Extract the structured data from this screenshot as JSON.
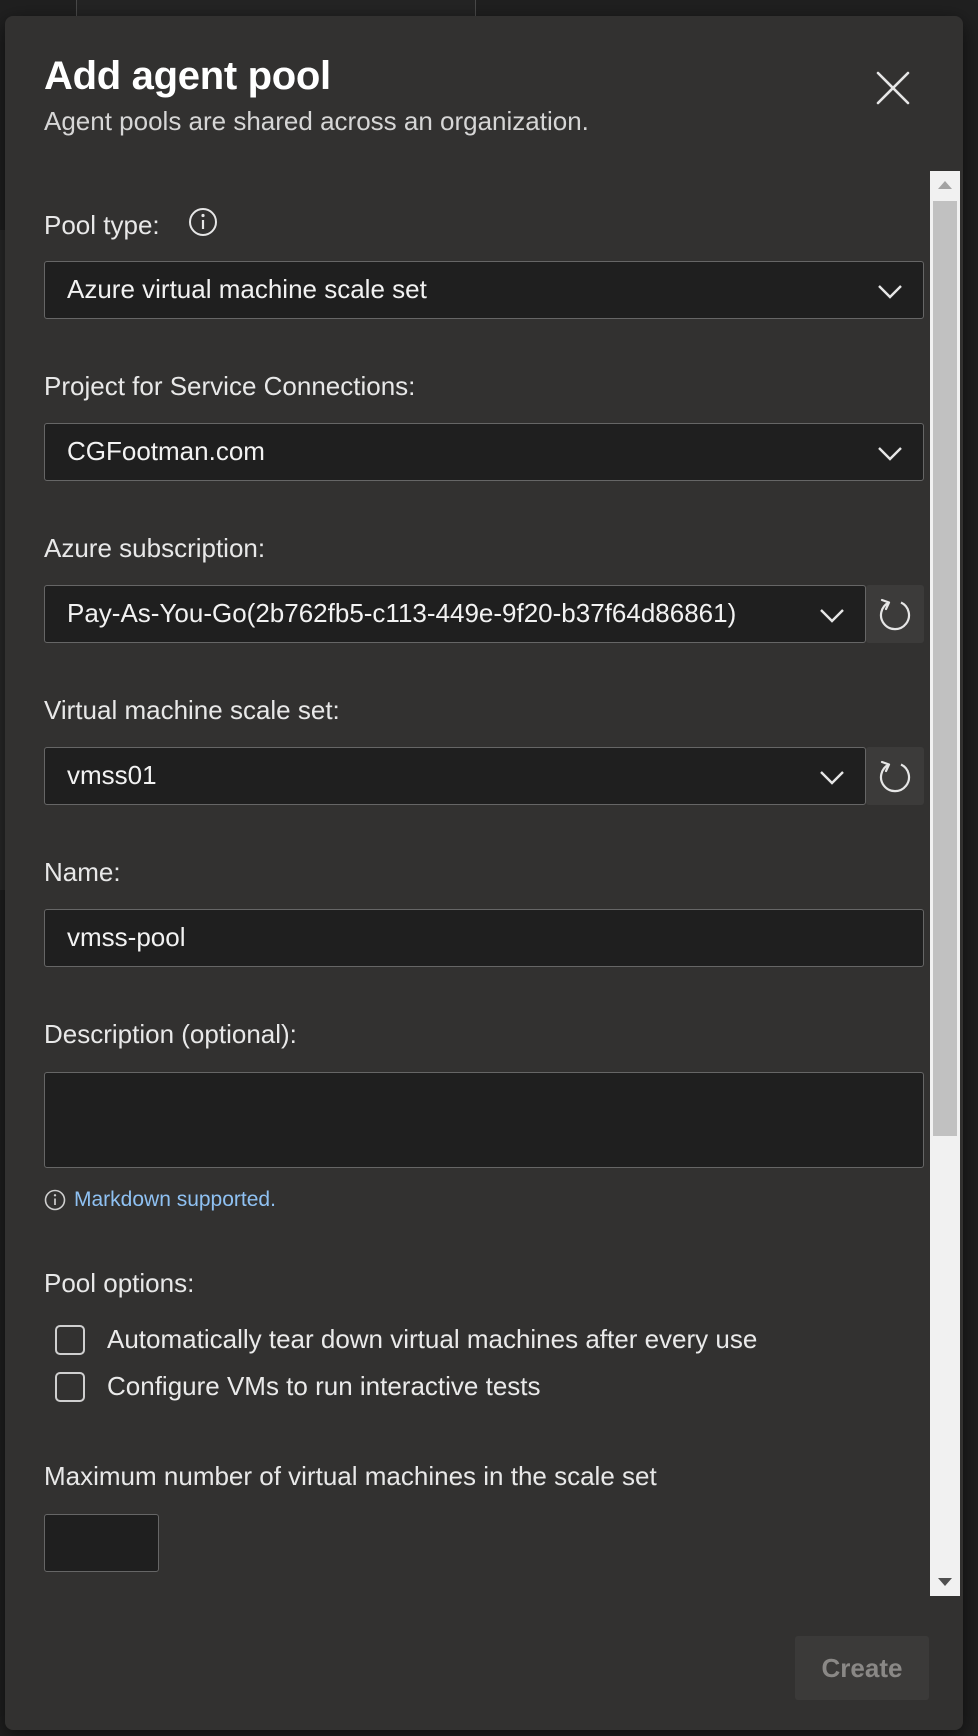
{
  "dialog": {
    "title": "Add agent pool",
    "subtitle": "Agent pools are shared across an organization.",
    "close_icon": "close-icon"
  },
  "pool_type": {
    "label": "Pool type:",
    "info_icon": "info-icon",
    "value": "Azure virtual machine scale set"
  },
  "project": {
    "label": "Project for Service Connections:",
    "value": "CGFootman.com"
  },
  "subscription": {
    "label": "Azure subscription:",
    "value": "Pay-As-You-Go(2b762fb5-c113-449e-9f20-b37f64d86861)",
    "refresh_icon": "refresh-icon"
  },
  "scale_set": {
    "label": "Virtual machine scale set:",
    "value": "vmss01",
    "refresh_icon": "refresh-icon"
  },
  "name": {
    "label": "Name:",
    "value": "vmss-pool"
  },
  "description": {
    "label": "Description (optional):",
    "value": "",
    "markdown_note": "Markdown supported."
  },
  "pool_options": {
    "label": "Pool options:",
    "options": [
      {
        "label": "Automatically tear down virtual machines after every use",
        "checked": false
      },
      {
        "label": "Configure VMs to run interactive tests",
        "checked": false
      }
    ]
  },
  "max_vms": {
    "label": "Maximum number of virtual machines in the scale set",
    "value": ""
  },
  "footer": {
    "create_label": "Create"
  },
  "colors": {
    "panel_bg": "#323130",
    "field_bg": "#1f1f1f",
    "link": "#8fc1f2",
    "disabled_button_bg": "#3b3a39"
  }
}
